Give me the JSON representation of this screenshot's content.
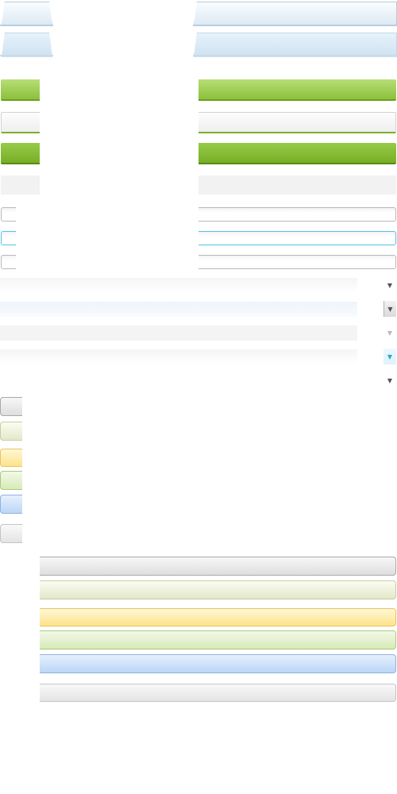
{
  "colors": {
    "tab_border": "#b6cadb",
    "green_light": "#b7de76",
    "green_dark": "#78ae26",
    "field_border": "#b9b9b9",
    "focus_border": "#54c4e6",
    "button_yellow": "#fde38a",
    "button_blue": "#bcd6f6"
  },
  "tabs": [
    {
      "state": "normal"
    },
    {
      "state": "active"
    }
  ],
  "green_bars": [
    {
      "state": "normal"
    },
    {
      "state": "selected"
    }
  ],
  "text_fields": [
    {
      "state": "normal"
    },
    {
      "state": "focused"
    },
    {
      "state": "disabled"
    }
  ],
  "combos": [
    {
      "state": "normal",
      "arrow_icon": "chevron-down-icon"
    },
    {
      "state": "hover",
      "arrow_icon": "chevron-down-icon"
    },
    {
      "state": "disabled",
      "arrow_icon": "chevron-down-icon"
    },
    {
      "state": "focused",
      "arrow_icon": "chevron-down-icon"
    },
    {
      "state": "trigger-only",
      "arrow_icon": "chevron-down-icon"
    }
  ],
  "buttons": [
    {
      "variant": "default"
    },
    {
      "variant": "olive"
    },
    {
      "variant": "yellow"
    },
    {
      "variant": "light-green"
    },
    {
      "variant": "blue"
    },
    {
      "variant": "grey"
    }
  ]
}
